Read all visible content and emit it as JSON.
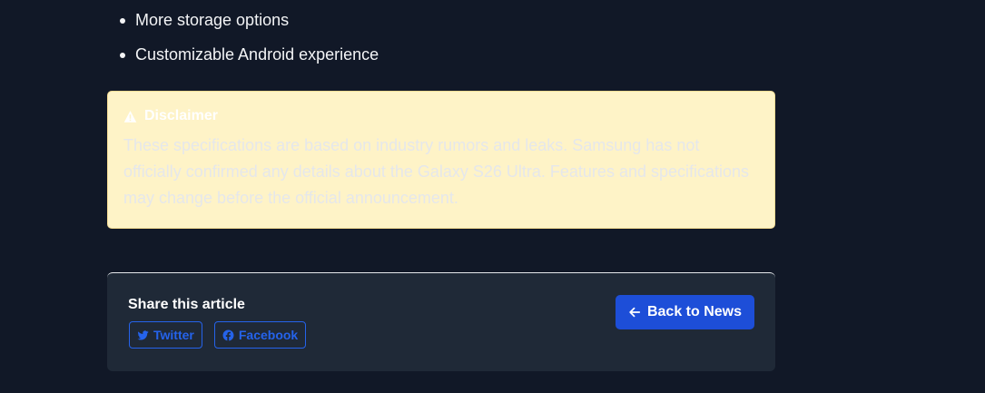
{
  "feature_list": {
    "items": [
      "More storage options",
      "Customizable Android experience"
    ]
  },
  "disclaimer": {
    "icon": "warning-triangle-icon",
    "title": "Disclaimer",
    "text": "These specifications are based on industry rumors and leaks. Samsung has not officially confirmed any details about the Galaxy S26 Ultra. Features and specifications may change before the official announcement.",
    "background_color": "#fef3c7",
    "title_color": "#ffffff",
    "text_color": "#e5e7eb"
  },
  "share": {
    "title": "Share this article",
    "twitter_label": "Twitter",
    "twitter_icon": "twitter-icon",
    "facebook_label": "Facebook",
    "facebook_icon": "facebook-icon",
    "accent_color": "#2563eb"
  },
  "navigation": {
    "back_label": "Back to News",
    "back_icon": "arrow-left-icon",
    "button_color": "#1d4ed8"
  },
  "theme": {
    "page_background": "#111827",
    "card_background": "#1f2937"
  }
}
